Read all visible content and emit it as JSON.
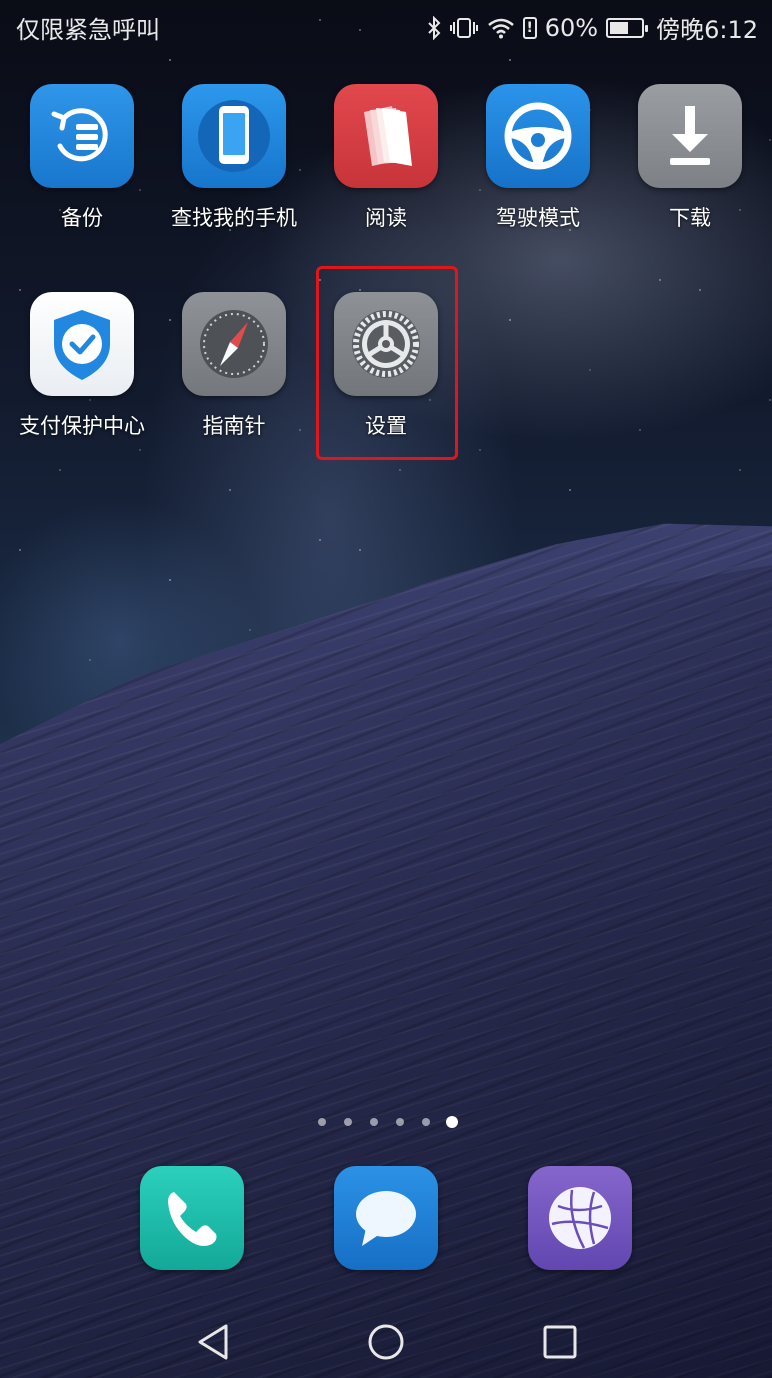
{
  "status_bar": {
    "carrier_text": "仅限紧急呼叫",
    "battery_percent": "60%",
    "battery_level": 0.6,
    "time": "傍晚6:12",
    "icons": [
      "bluetooth-icon",
      "vibrate-icon",
      "wifi-icon",
      "alert-icon",
      "battery-icon"
    ]
  },
  "home_apps": [
    {
      "label": "备份",
      "icon": "backup-icon",
      "color": "#2f96ea"
    },
    {
      "label": "查找我的手机",
      "icon": "find-phone-icon",
      "color": "#2c98ec"
    },
    {
      "label": "阅读",
      "icon": "book-icon",
      "color": "#e2484d"
    },
    {
      "label": "驾驶模式",
      "icon": "steering-wheel-icon",
      "color": "#2a94ea"
    },
    {
      "label": "下载",
      "icon": "download-icon",
      "color": "#9a9ea3"
    },
    {
      "label": "支付保护中心",
      "icon": "shield-check-icon",
      "color": "#ffffff"
    },
    {
      "label": "指南针",
      "icon": "compass-icon",
      "color": "#8f9398"
    },
    {
      "label": "设置",
      "icon": "gear-icon",
      "color": "#8e9297",
      "highlighted": true
    }
  ],
  "page_indicator": {
    "count": 6,
    "active_index": 5
  },
  "dock": [
    {
      "name": "phone",
      "icon": "phone-icon",
      "color": "#2bd0bd"
    },
    {
      "name": "messages",
      "icon": "chat-bubble-icon",
      "color": "#2b92e6"
    },
    {
      "name": "browser",
      "icon": "globe-icon",
      "color": "#8566cc"
    }
  ],
  "nav_bar": {
    "icons": [
      "back-icon",
      "home-icon",
      "recents-icon"
    ]
  },
  "colors": {
    "highlight_box": "#e0161b"
  }
}
